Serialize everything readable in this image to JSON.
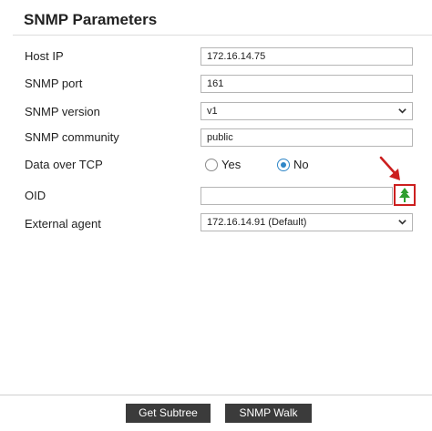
{
  "panel": {
    "title": "SNMP Parameters"
  },
  "fields": {
    "host_ip": {
      "label": "Host IP",
      "value": "172.16.14.75"
    },
    "snmp_port": {
      "label": "SNMP port",
      "value": "161"
    },
    "snmp_version": {
      "label": "SNMP version",
      "value": "v1"
    },
    "snmp_community": {
      "label": "SNMP community",
      "value": "public"
    },
    "data_over_tcp": {
      "label": "Data over TCP",
      "options": [
        "Yes",
        "No"
      ],
      "selected": "No"
    },
    "oid": {
      "label": "OID",
      "value": ""
    },
    "external_agent": {
      "label": "External agent",
      "value": "172.16.14.91 (Default)"
    }
  },
  "buttons": {
    "get_subtree": "Get Subtree",
    "snmp_walk": "SNMP Walk"
  },
  "icons": {
    "oid_browse": "tree-icon",
    "annotation": "red-arrow-icon",
    "dropdown": "chevron-down-icon"
  },
  "colors": {
    "accent_radio": "#2f86c7",
    "tree_icon": "#2e9e2e",
    "annotation_red": "#cc1f1f",
    "button_bg": "#3b3b3b"
  }
}
